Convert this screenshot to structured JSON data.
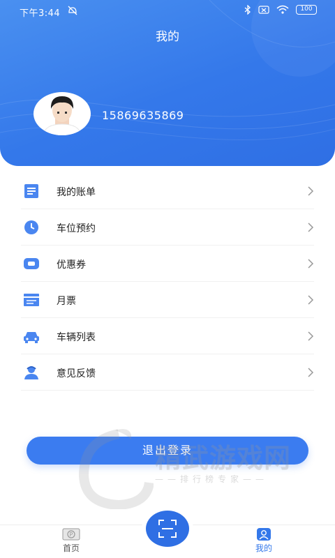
{
  "status_bar": {
    "time": "下午3:44",
    "battery": "100"
  },
  "page": {
    "title": "我的"
  },
  "profile": {
    "phone": "15869635869"
  },
  "menu": {
    "items": [
      {
        "label": "我的账单",
        "icon": "bill-icon"
      },
      {
        "label": "车位预约",
        "icon": "clock-icon"
      },
      {
        "label": "优惠券",
        "icon": "coupon-icon"
      },
      {
        "label": "月票",
        "icon": "ticket-icon"
      },
      {
        "label": "车辆列表",
        "icon": "car-icon"
      },
      {
        "label": "意见反馈",
        "icon": "feedback-icon"
      }
    ]
  },
  "logout": {
    "label": "退出登录"
  },
  "watermark": {
    "title": "精武游戏网",
    "subtitle": "——排行榜专家——"
  },
  "tabbar": {
    "home_label": "首页",
    "mine_label": "我的",
    "scan_icon": "scan-icon"
  },
  "colors": {
    "primary": "#3478ea",
    "hero_light": "#4a90f0",
    "icon_blue": "#4a86f0"
  }
}
